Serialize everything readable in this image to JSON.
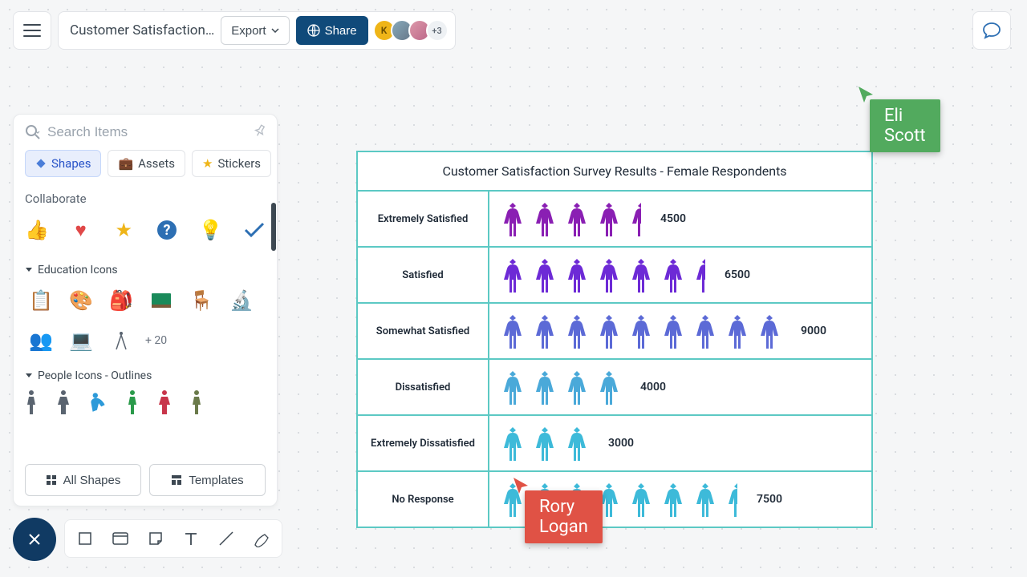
{
  "header": {
    "title": "Customer Satisfaction…",
    "export": "Export",
    "share": "Share",
    "avatar_letter": "K",
    "more_avatars": "+3"
  },
  "panel": {
    "search_placeholder": "Search Items",
    "tabs": {
      "shapes": "Shapes",
      "assets": "Assets",
      "stickers": "Stickers"
    },
    "section_collaborate": "Collaborate",
    "section_education": "Education Icons",
    "more_education": "+ 20",
    "section_people": "People Icons - Outlines",
    "all_shapes": "All Shapes",
    "templates": "Templates"
  },
  "cursors": {
    "eli": "Eli Scott",
    "rory": "Rory Logan"
  },
  "chart_data": {
    "type": "pictograph",
    "title": "Customer Satisfaction Survey Results - Female Respondents",
    "unit_value": 1000,
    "rows": [
      {
        "label": "Extremely Satisfied",
        "value": 4500,
        "icons": 4.5,
        "color": "#8a1fb3"
      },
      {
        "label": "Satisfied",
        "value": 6500,
        "icons": 6.5,
        "color": "#6d2ad6"
      },
      {
        "label": "Somewhat Satisfied",
        "value": 9000,
        "icons": 9,
        "color": "#5c6ad6"
      },
      {
        "label": "Dissatisfied",
        "value": 4000,
        "icons": 4,
        "color": "#4aa9d9"
      },
      {
        "label": "Extremely Dissatisfied",
        "value": 3000,
        "icons": 3,
        "color": "#3dbad9"
      },
      {
        "label": "No Response",
        "value": 7500,
        "icons": 7.5,
        "color": "#3dbad9"
      }
    ]
  }
}
